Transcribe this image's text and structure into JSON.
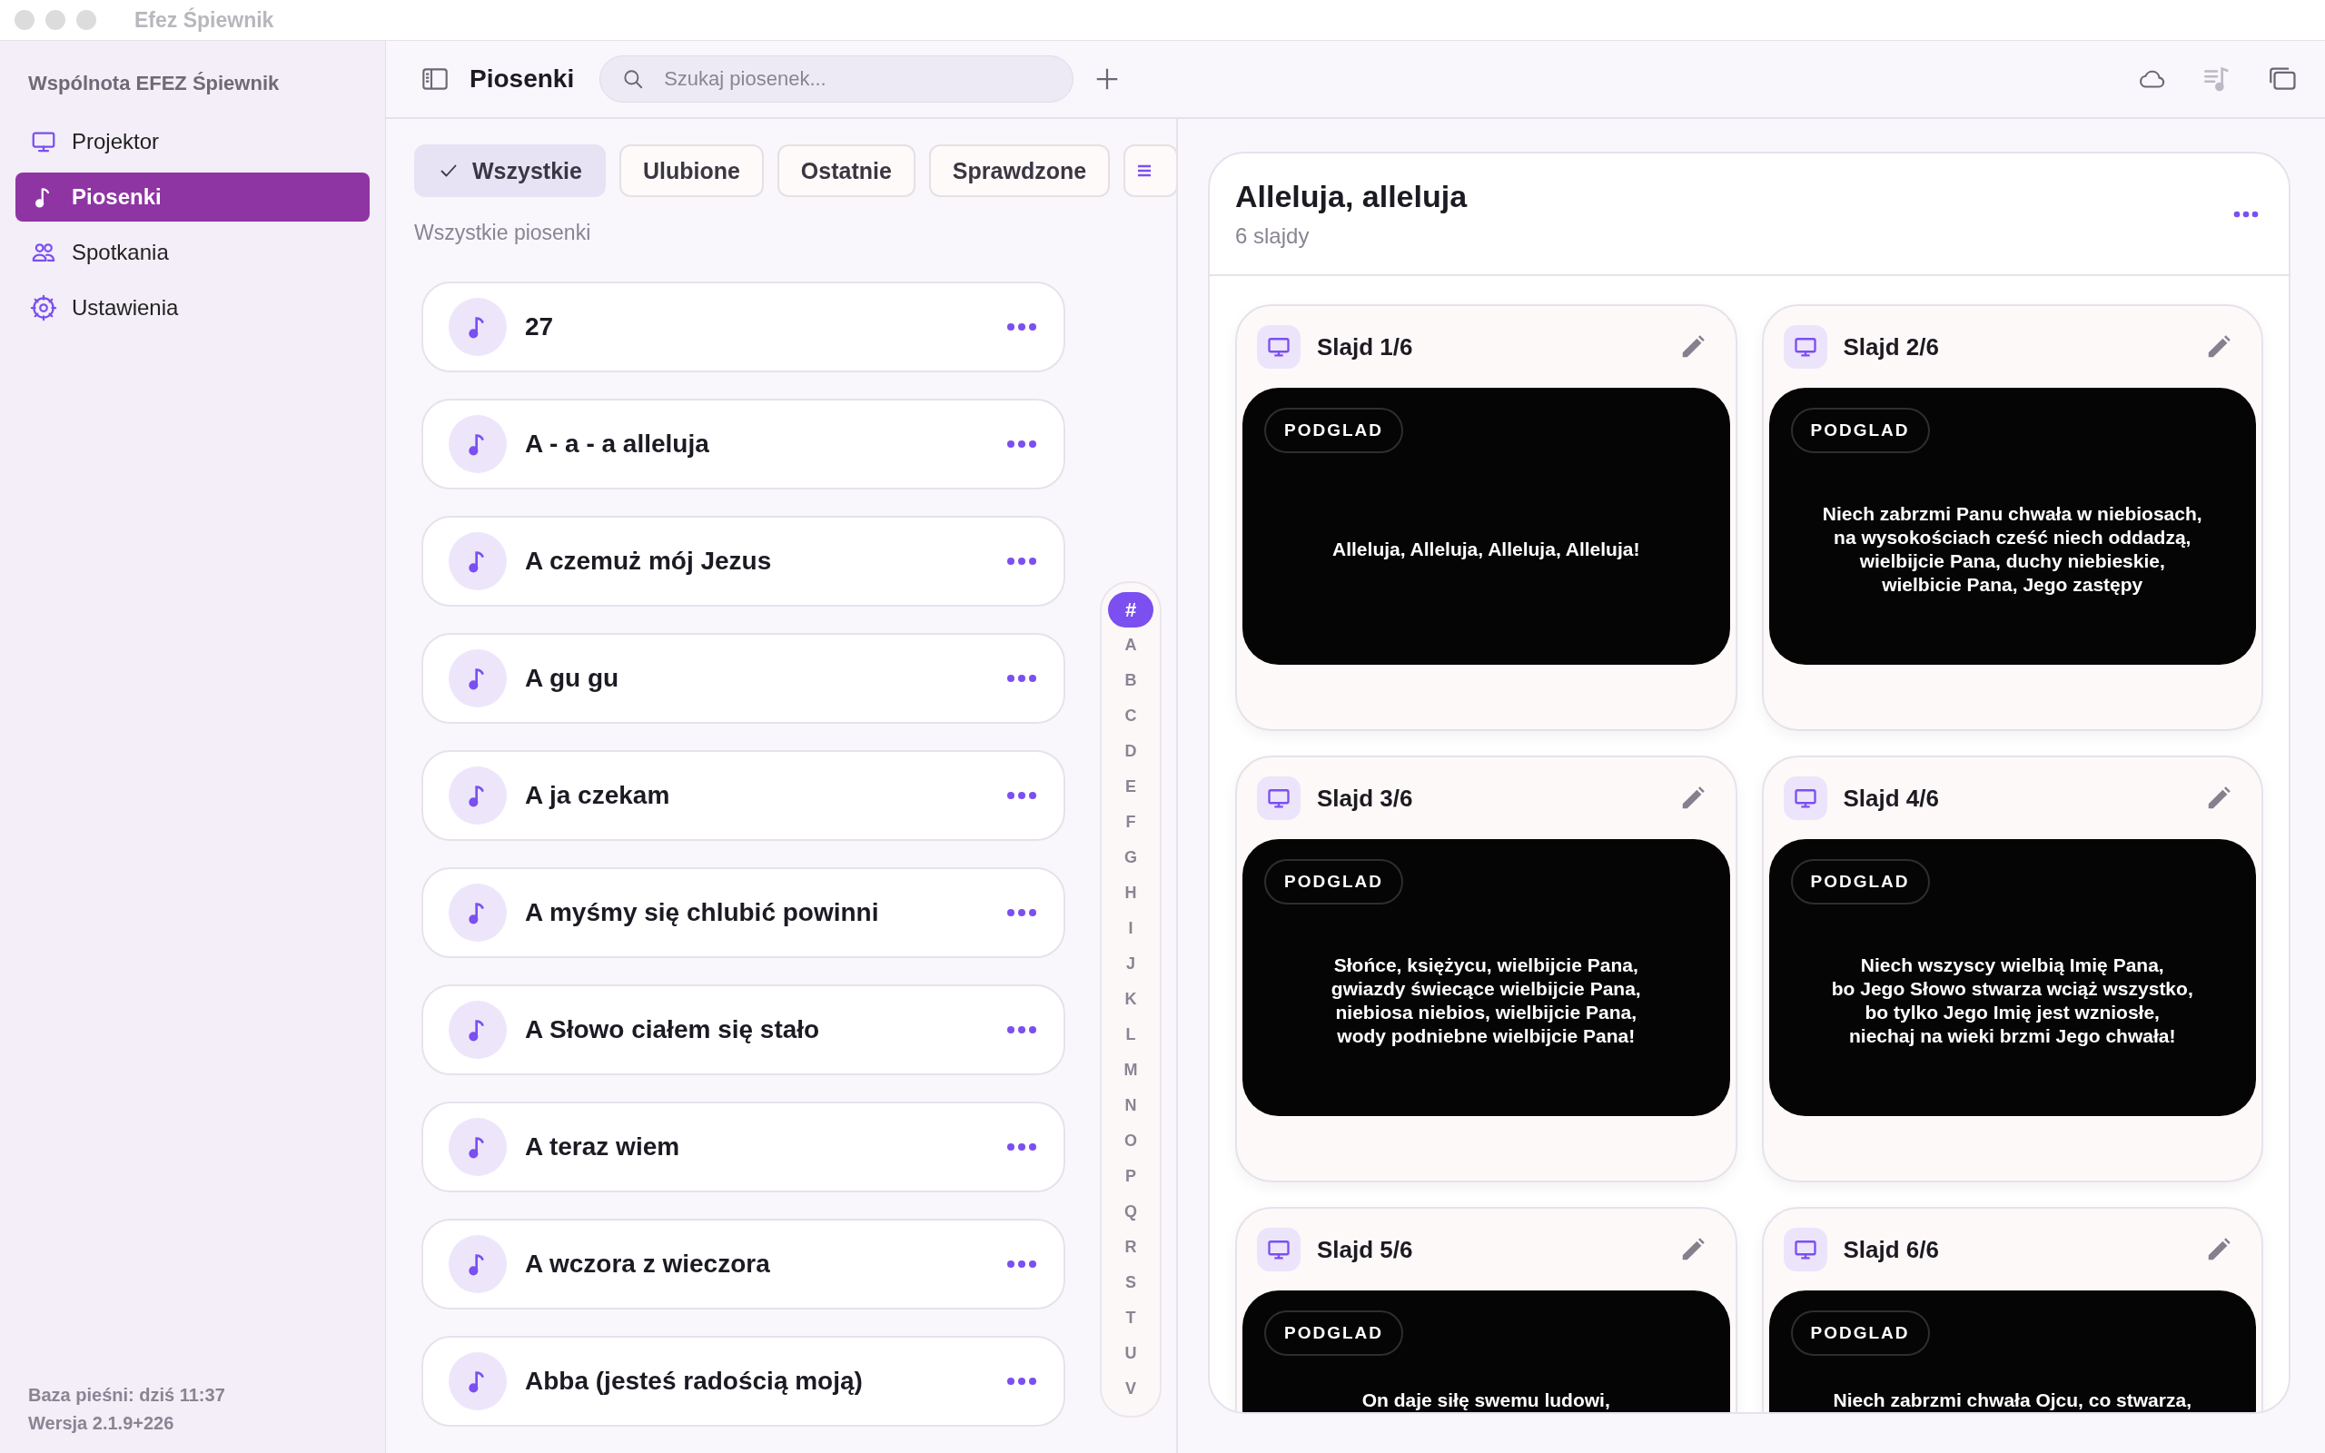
{
  "window": {
    "title": "Efez Śpiewnik"
  },
  "sidebar": {
    "title": "Wspólnota EFEZ Śpiewnik",
    "items": [
      {
        "label": "Projektor",
        "kind": "projector",
        "selected": false
      },
      {
        "label": "Piosenki",
        "kind": "songs",
        "selected": true
      },
      {
        "label": "Spotkania",
        "kind": "meetings",
        "selected": false
      },
      {
        "label": "Ustawienia",
        "kind": "settings",
        "selected": false
      }
    ],
    "footer": [
      "Baza pieśni: dziś 11:37",
      "Wersja 2.1.9+226"
    ]
  },
  "toolbar": {
    "title": "Piosenki",
    "search": {
      "placeholder": "Szukaj piosenek..."
    }
  },
  "filters": [
    {
      "label": "Wszystkie",
      "selected": true
    },
    {
      "label": "Ulubione",
      "selected": false
    },
    {
      "label": "Ostatnie",
      "selected": false
    },
    {
      "label": "Sprawdzone",
      "selected": false
    }
  ],
  "list_caption": "Wszystkie piosenki",
  "songs": [
    {
      "title": "27",
      "selected": false
    },
    {
      "title": "A - a - a alleluja",
      "selected": false
    },
    {
      "title": "A czemuż mój Jezus",
      "selected": false
    },
    {
      "title": "A gu gu",
      "selected": false
    },
    {
      "title": "A ja czekam",
      "selected": false
    },
    {
      "title": "A myśmy się chlubić powinni",
      "selected": false
    },
    {
      "title": "A Słowo ciałem się stało",
      "selected": false
    },
    {
      "title": "A teraz wiem",
      "selected": false
    },
    {
      "title": "A wczora z wieczora",
      "selected": false
    },
    {
      "title": "Abba (jesteś radością moją)",
      "selected": false
    }
  ],
  "index": [
    {
      "label": "#",
      "selected": true
    },
    {
      "label": "A",
      "selected": false
    },
    {
      "label": "B",
      "selected": false
    },
    {
      "label": "C",
      "selected": false
    },
    {
      "label": "D",
      "selected": false
    },
    {
      "label": "E",
      "selected": false
    },
    {
      "label": "F",
      "selected": false
    },
    {
      "label": "G",
      "selected": false
    },
    {
      "label": "H",
      "selected": false
    },
    {
      "label": "I",
      "selected": false
    },
    {
      "label": "J",
      "selected": false
    },
    {
      "label": "K",
      "selected": false
    },
    {
      "label": "L",
      "selected": false
    },
    {
      "label": "M",
      "selected": false
    },
    {
      "label": "N",
      "selected": false
    },
    {
      "label": "O",
      "selected": false
    },
    {
      "label": "P",
      "selected": false
    },
    {
      "label": "Q",
      "selected": false
    },
    {
      "label": "R",
      "selected": false
    },
    {
      "label": "S",
      "selected": false
    },
    {
      "label": "T",
      "selected": false
    },
    {
      "label": "U",
      "selected": false
    },
    {
      "label": "V",
      "selected": false
    }
  ],
  "detail": {
    "title": "Alleluja, alleluja",
    "subtitle": "6 slajdy",
    "slides": [
      {
        "label": "Slajd 1/6",
        "badge": "PODGLAD",
        "text": "Alleluja, Alleluja, Alleluja, Alleluja!"
      },
      {
        "label": "Slajd 2/6",
        "badge": "PODGLAD",
        "text": "Niech zabrzmi Panu chwała w niebiosach,\nna wysokościach cześć niech oddadzą,\nwielbijcie Pana, duchy niebieskie,\nwielbicie Pana, Jego zastępy"
      },
      {
        "label": "Slajd 3/6",
        "badge": "PODGLAD",
        "text": "Słońce, księżycu, wielbijcie Pana,\ngwiazdy świecące wielbijcie Pana,\nniebiosa niebios, wielbijcie Pana,\nwody podniebne wielbijcie Pana!"
      },
      {
        "label": "Slajd 4/6",
        "badge": "PODGLAD",
        "text": "Niech wszyscy wielbią Imię Pana,\nbo Jego Słowo stwarza wciąż wszystko,\nbo tylko Jego Imię jest wzniosłe,\nniechaj na wieki brzmi Jego chwała!"
      },
      {
        "label": "Slajd 5/6",
        "badge": "PODGLAD",
        "text": "On daje siłę swemu ludowi,"
      },
      {
        "label": "Slajd 6/6",
        "badge": "PODGLAD",
        "text": "Niech zabrzmi chwała Ojcu, co stwarza,"
      }
    ]
  }
}
